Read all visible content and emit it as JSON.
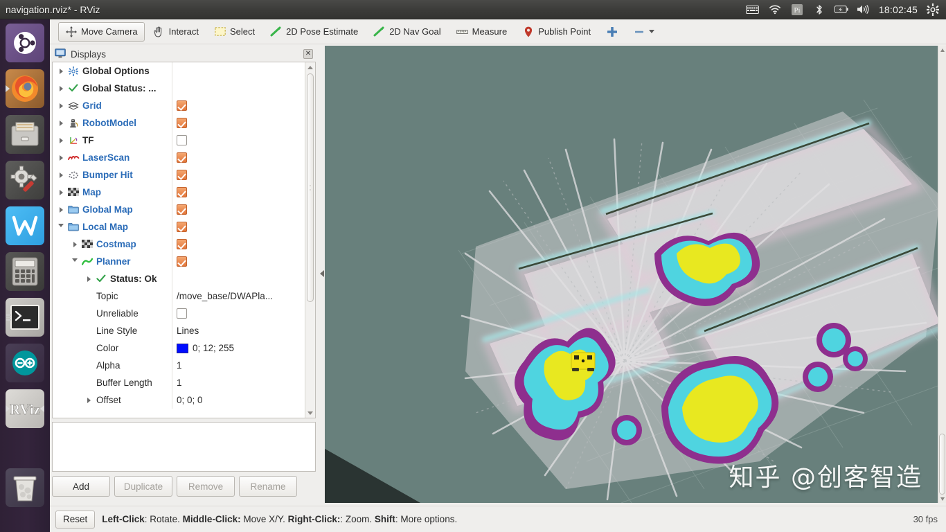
{
  "window": {
    "title": "navigation.rviz* - RViz"
  },
  "tray": {
    "icons": [
      "keyboard-icon",
      "wifi-icon",
      "pi-icon",
      "bluetooth-icon",
      "battery-icon",
      "volume-icon"
    ],
    "clock": "18:02:45",
    "gear": "gear-icon"
  },
  "launcher": {
    "items": [
      {
        "name": "ubuntu-dash",
        "label": "Ubuntu"
      },
      {
        "name": "firefox",
        "label": "Firefox"
      },
      {
        "name": "files",
        "label": "Files"
      },
      {
        "name": "system-settings",
        "label": "System Settings"
      },
      {
        "name": "wps-office",
        "label": "WPS"
      },
      {
        "name": "calculator",
        "label": "Calculator"
      },
      {
        "name": "terminal",
        "label": "Terminal"
      },
      {
        "name": "arduino",
        "label": "Arduino"
      },
      {
        "name": "rviz",
        "label": "RViz"
      },
      {
        "name": "trash",
        "label": "Trash"
      }
    ]
  },
  "toolbar": {
    "move_camera": "Move Camera",
    "interact": "Interact",
    "select": "Select",
    "pose_estimate": "2D Pose Estimate",
    "nav_goal": "2D Nav Goal",
    "measure": "Measure",
    "publish_point": "Publish Point",
    "add_tool": "+",
    "remove_tool": "-"
  },
  "displays": {
    "title": "Displays",
    "close": "✕",
    "tree": [
      {
        "indent": 0,
        "arrow": "closed",
        "icon": "gear-icon",
        "label": "Global Options",
        "style": "dark-bold",
        "value_type": "none"
      },
      {
        "indent": 0,
        "arrow": "closed",
        "icon": "check-icon",
        "label": "Global Status: ...",
        "style": "dark-bold",
        "value_type": "none"
      },
      {
        "indent": 0,
        "arrow": "closed",
        "icon": "grid-icon",
        "label": "Grid",
        "style": "blue",
        "value_type": "checkbox",
        "checked": true
      },
      {
        "indent": 0,
        "arrow": "closed",
        "icon": "robot-icon",
        "label": "RobotModel",
        "style": "blue",
        "value_type": "checkbox",
        "checked": true
      },
      {
        "indent": 0,
        "arrow": "closed",
        "icon": "tf-icon",
        "label": "TF",
        "style": "dark-bold",
        "value_type": "checkbox",
        "checked": false
      },
      {
        "indent": 0,
        "arrow": "closed",
        "icon": "laserscan-icon",
        "label": "LaserScan",
        "style": "blue",
        "value_type": "checkbox",
        "checked": true
      },
      {
        "indent": 0,
        "arrow": "closed",
        "icon": "pointcloud-icon",
        "label": "Bumper Hit",
        "style": "blue",
        "value_type": "checkbox",
        "checked": true
      },
      {
        "indent": 0,
        "arrow": "closed",
        "icon": "map-icon",
        "label": "Map",
        "style": "blue",
        "value_type": "checkbox",
        "checked": true
      },
      {
        "indent": 0,
        "arrow": "closed",
        "icon": "folder-icon",
        "label": "Global Map",
        "style": "blue",
        "value_type": "checkbox",
        "checked": true
      },
      {
        "indent": 0,
        "arrow": "open",
        "icon": "folder-icon",
        "label": "Local Map",
        "style": "blue",
        "value_type": "checkbox",
        "checked": true
      },
      {
        "indent": 1,
        "arrow": "closed",
        "icon": "map-icon",
        "label": "Costmap",
        "style": "blue",
        "value_type": "checkbox",
        "checked": true
      },
      {
        "indent": 1,
        "arrow": "open",
        "icon": "path-icon",
        "label": "Planner",
        "style": "blue",
        "value_type": "checkbox",
        "checked": true
      },
      {
        "indent": 2,
        "arrow": "closed",
        "icon": "check-icon",
        "label": "Status: Ok",
        "style": "dark-bold",
        "value_type": "none"
      },
      {
        "indent": 2,
        "arrow": "none",
        "icon": "none",
        "label": "Topic",
        "style": "dark",
        "value_type": "text",
        "value": "/move_base/DWAPla..."
      },
      {
        "indent": 2,
        "arrow": "none",
        "icon": "none",
        "label": "Unreliable",
        "style": "dark",
        "value_type": "checkbox",
        "checked": false
      },
      {
        "indent": 2,
        "arrow": "none",
        "icon": "none",
        "label": "Line Style",
        "style": "dark",
        "value_type": "text",
        "value": "Lines"
      },
      {
        "indent": 2,
        "arrow": "none",
        "icon": "none",
        "label": "Color",
        "style": "dark",
        "value_type": "color",
        "value": "0; 12; 255",
        "swatch": "#000CFF"
      },
      {
        "indent": 2,
        "arrow": "none",
        "icon": "none",
        "label": "Alpha",
        "style": "dark",
        "value_type": "text",
        "value": "1"
      },
      {
        "indent": 2,
        "arrow": "none",
        "icon": "none",
        "label": "Buffer Length",
        "style": "dark",
        "value_type": "text",
        "value": "1"
      },
      {
        "indent": 2,
        "arrow": "closed",
        "icon": "none",
        "label": "Offset",
        "style": "dark",
        "value_type": "text",
        "value": "0; 0; 0"
      }
    ],
    "buttons": {
      "add": "Add",
      "duplicate": "Duplicate",
      "remove": "Remove",
      "rename": "Rename"
    }
  },
  "viewport": {
    "watermark": "知乎 @创客智造",
    "background": "#68807c"
  },
  "statusbar": {
    "reset": "Reset",
    "hint_parts": [
      {
        "text": "Left-Click",
        "bold": true
      },
      {
        "text": ": Rotate. ",
        "bold": false
      },
      {
        "text": "Middle-Click:",
        "bold": true
      },
      {
        "text": " Move X/Y. ",
        "bold": false
      },
      {
        "text": "Right-Click:",
        "bold": true
      },
      {
        "text": ": Zoom. ",
        "bold": false
      },
      {
        "text": "Shift",
        "bold": true
      },
      {
        "text": ": More options.",
        "bold": false
      }
    ],
    "fps": "30 fps"
  }
}
